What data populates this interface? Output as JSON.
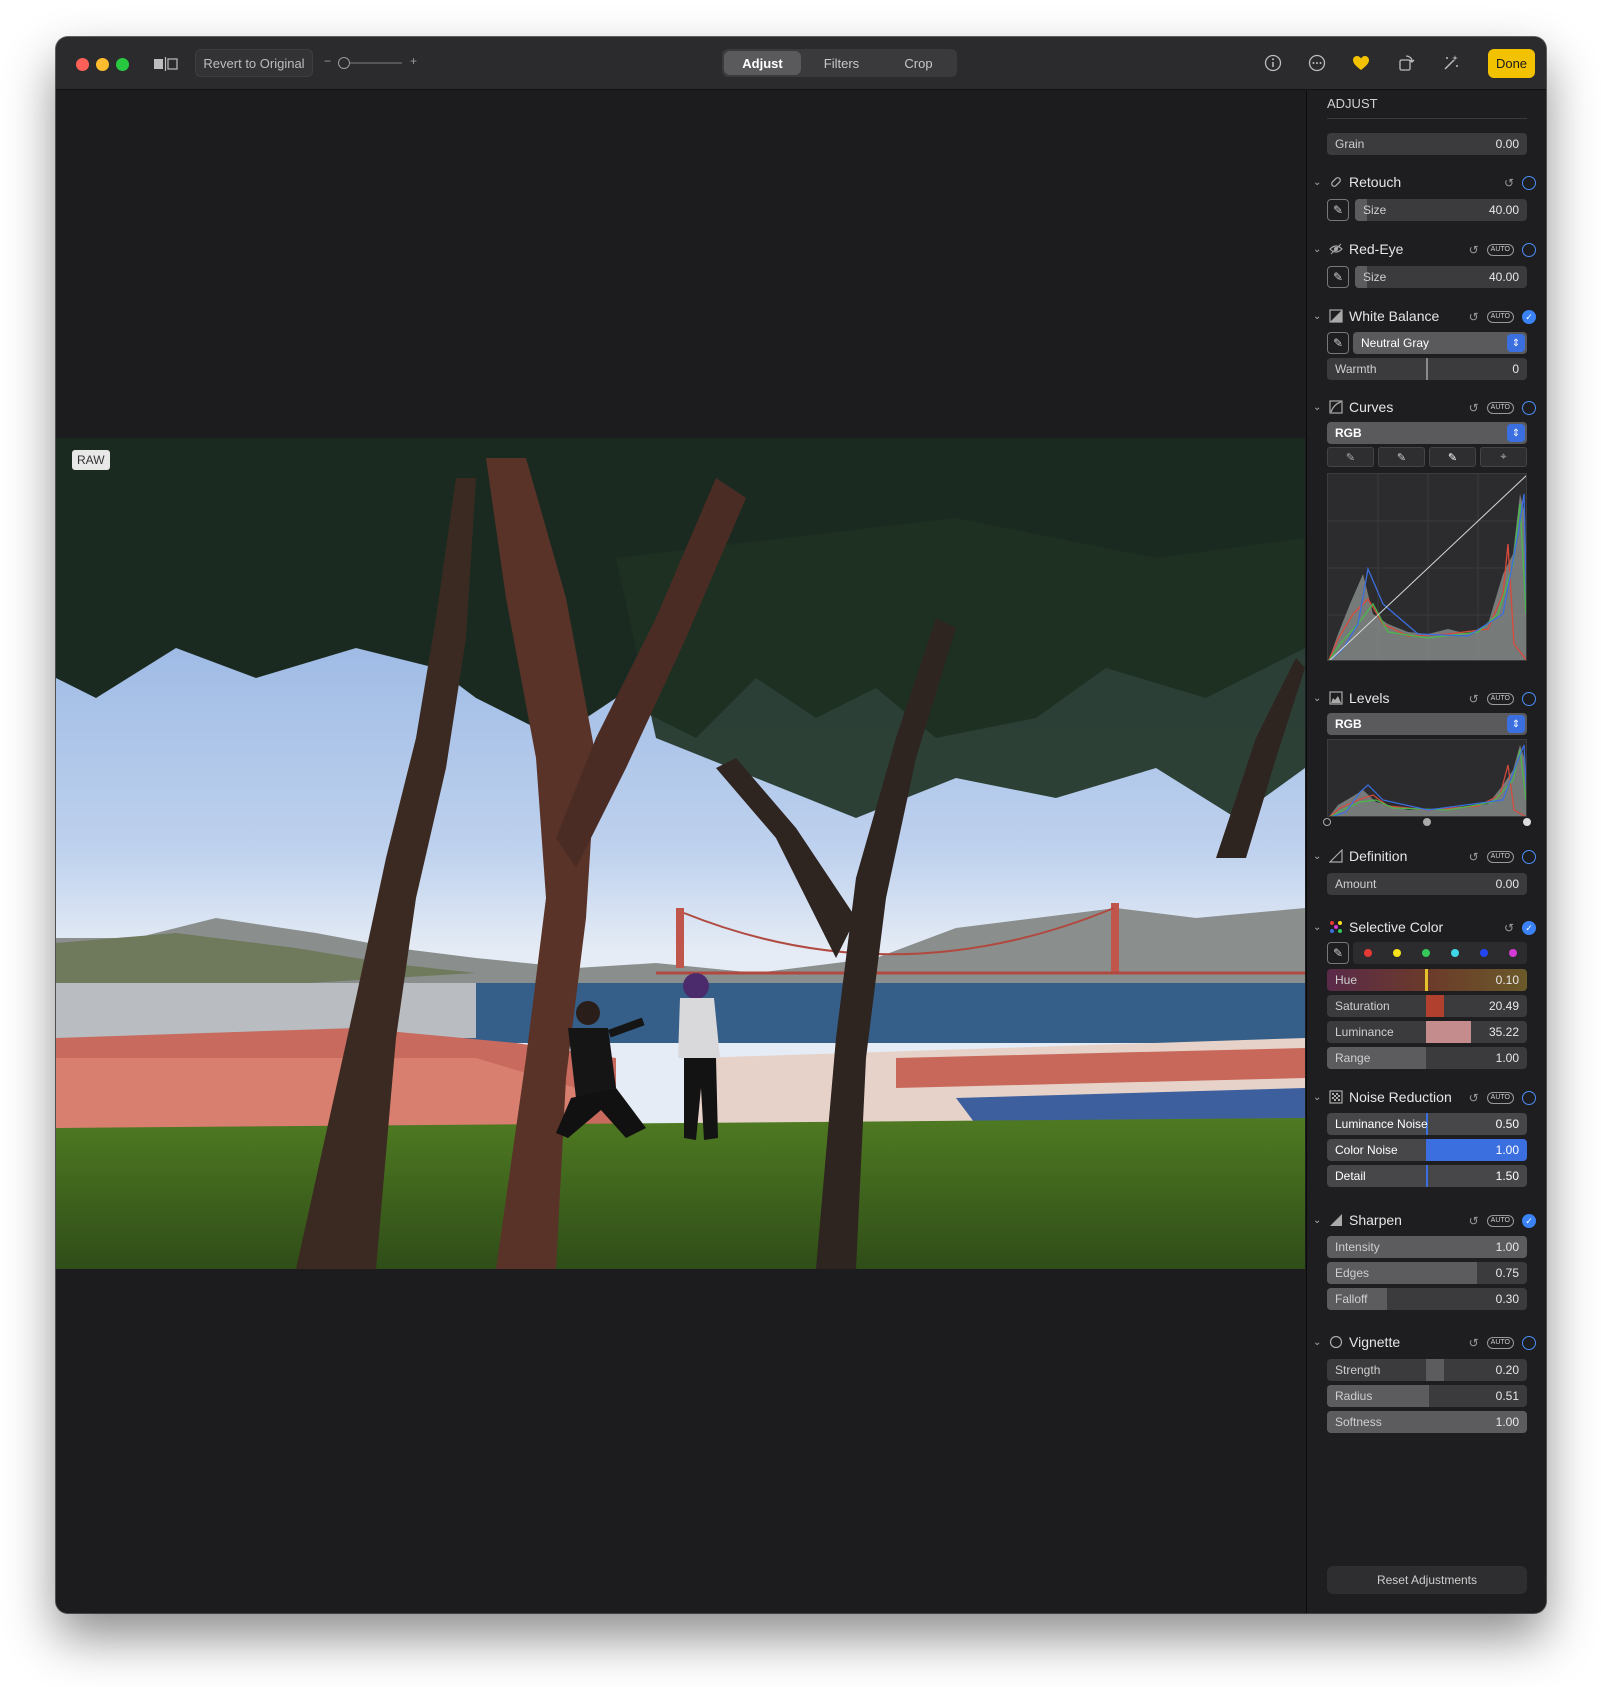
{
  "toolbar": {
    "revert_label": "Revert to Original",
    "zoom_minus": "−",
    "zoom_plus": "+",
    "tabs": [
      "Adjust",
      "Filters",
      "Crop"
    ],
    "active_tab": "Adjust",
    "done_label": "Done",
    "icons": [
      "info-icon",
      "more-icon",
      "favorite-heart-icon",
      "rotate-icon",
      "auto-enhance-icon"
    ],
    "accent": "#f2c200"
  },
  "photo": {
    "badge": "RAW"
  },
  "sidebar": {
    "heading": "ADJUST",
    "grain": {
      "label": "Grain",
      "value": "0.00"
    },
    "retouch": {
      "title": "Retouch",
      "size_label": "Size",
      "size_value": "40.00"
    },
    "redeye": {
      "title": "Red-Eye",
      "size_label": "Size",
      "size_value": "40.00"
    },
    "white_balance": {
      "title": "White Balance",
      "mode": "Neutral Gray",
      "warmth_label": "Warmth",
      "warmth_value": "0"
    },
    "curves": {
      "title": "Curves",
      "channel": "RGB"
    },
    "levels": {
      "title": "Levels",
      "channel": "RGB"
    },
    "definition": {
      "title": "Definition",
      "amount_label": "Amount",
      "amount_value": "0.00"
    },
    "selective_color": {
      "title": "Selective Color",
      "swatches": [
        "#e53935",
        "#f6e21a",
        "#35c759",
        "#3fd6e6",
        "#2346f5",
        "#d43ad4"
      ],
      "hue_label": "Hue",
      "hue_value": "0.10",
      "saturation_label": "Saturation",
      "saturation_value": "20.49",
      "luminance_label": "Luminance",
      "luminance_value": "35.22",
      "range_label": "Range",
      "range_value": "1.00"
    },
    "noise_reduction": {
      "title": "Noise Reduction",
      "luminance_label": "Luminance Noise",
      "luminance_value": "0.50",
      "color_label": "Color Noise",
      "color_value": "1.00",
      "detail_label": "Detail",
      "detail_value": "1.50"
    },
    "sharpen": {
      "title": "Sharpen",
      "intensity_label": "Intensity",
      "intensity_value": "1.00",
      "edges_label": "Edges",
      "edges_value": "0.75",
      "falloff_label": "Falloff",
      "falloff_value": "0.30"
    },
    "vignette": {
      "title": "Vignette",
      "strength_label": "Strength",
      "strength_value": "0.20",
      "radius_label": "Radius",
      "radius_value": "0.51",
      "softness_label": "Softness",
      "softness_value": "1.00"
    },
    "auto_label": "AUTO",
    "reset_label": "Reset Adjustments"
  }
}
